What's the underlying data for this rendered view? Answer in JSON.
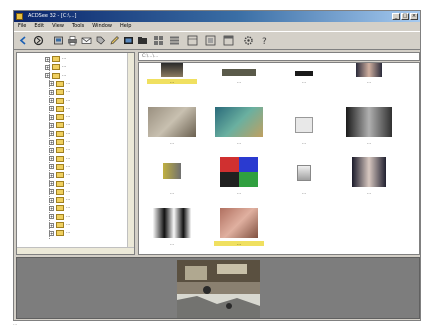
{
  "window": {
    "title": "ACDSee 32 - [C:\\...]"
  },
  "menus": [
    "File",
    "Edit",
    "View",
    "Tools",
    "Window",
    "Help"
  ],
  "toolbar": {
    "icons": [
      "back-icon",
      "forward-icon",
      "browse-icon",
      "print-icon",
      "email-icon",
      "tag-icon",
      "edit-icon",
      "slideshow-icon",
      "folder-icon",
      "thumbs-icon",
      "details-icon",
      "list-icon",
      "large-icon",
      "help-icon"
    ]
  },
  "tree": {
    "items": [
      "...",
      "...",
      "...",
      "...",
      "...",
      "...",
      "...",
      "...",
      "...",
      "...",
      "...",
      "...",
      "...",
      "...",
      "...",
      "...",
      "...",
      "...",
      "...",
      "...",
      "...",
      "..."
    ]
  },
  "address": {
    "value": "C:\\...\\..."
  },
  "thumbnails": [
    {
      "caption": "...",
      "selected": true
    },
    {
      "caption": "...",
      "selected": false
    },
    {
      "caption": "...",
      "selected": false
    },
    {
      "caption": "...",
      "selected": false
    },
    {
      "caption": "...",
      "selected": false
    },
    {
      "caption": "...",
      "selected": false
    },
    {
      "caption": "...",
      "selected": false
    },
    {
      "caption": "...",
      "selected": false
    },
    {
      "caption": "...",
      "selected": false
    },
    {
      "caption": "...",
      "selected": false
    },
    {
      "caption": "...",
      "selected": false
    },
    {
      "caption": "...",
      "selected": false
    },
    {
      "caption": "...",
      "selected": false
    },
    {
      "caption": "...",
      "selected": true
    }
  ],
  "status": {
    "text": "..."
  },
  "colors": {
    "title_start": "#0a246a",
    "title_end": "#a6caf0",
    "chrome": "#d4d0c8",
    "preview_bg": "#7d7d7d",
    "selection": "#f0e060",
    "folder": "#f0d060"
  }
}
